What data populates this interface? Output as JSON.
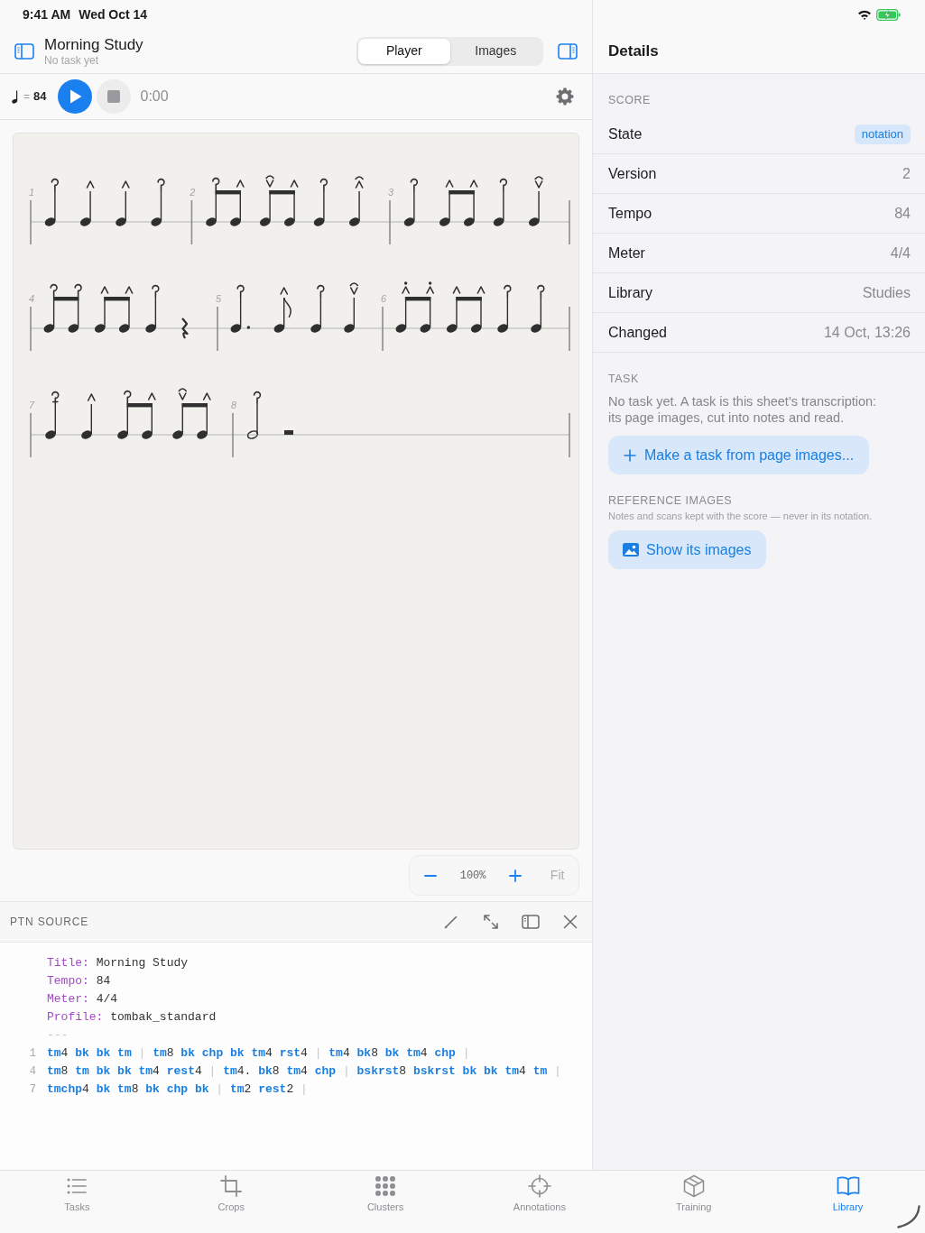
{
  "status_bar": {
    "time": "9:41 AM",
    "date": "Wed Oct 14"
  },
  "nav": {
    "title": "Morning Study",
    "subtitle": "No task yet",
    "segments": [
      {
        "label": "Player",
        "selected": true
      },
      {
        "label": "Images",
        "selected": false
      }
    ]
  },
  "player": {
    "tempo_sign": "=",
    "tempo": "84",
    "playing": false,
    "stop_disabled": true,
    "time": "0:00"
  },
  "score": {
    "systems": [
      {
        "measures": [
          {
            "number": "1",
            "items": [
              {
                "kind": "quarter",
                "marks": [
                  {
                    "kind": "hook"
                  }
                ]
              },
              {
                "kind": "quarter",
                "marks": [
                  {
                    "kind": "caret"
                  }
                ]
              },
              {
                "kind": "quarter",
                "marks": [
                  {
                    "kind": "caret"
                  }
                ]
              },
              {
                "kind": "quarter",
                "marks": [
                  {
                    "kind": "hook"
                  }
                ]
              }
            ]
          },
          {
            "number": "2",
            "items": [
              {
                "kind": "beamed_eighths",
                "marks": [
                  {
                    "kind": "hook"
                  },
                  {
                    "kind": "caret"
                  }
                ]
              },
              {
                "kind": "beamed_eighths",
                "marks": [
                  {
                    "kind": "arched_v"
                  },
                  {
                    "kind": "caret"
                  }
                ]
              },
              {
                "kind": "quarter",
                "marks": [
                  {
                    "kind": "hook"
                  }
                ]
              },
              {
                "kind": "quarter",
                "marks": [
                  {
                    "kind": "arched_caret"
                  }
                ]
              }
            ]
          },
          {
            "number": "3",
            "items": [
              {
                "kind": "quarter",
                "marks": [
                  {
                    "kind": "hook"
                  }
                ]
              },
              {
                "kind": "beamed_eighths",
                "marks": [
                  {
                    "kind": "caret"
                  },
                  {
                    "kind": "caret"
                  }
                ]
              },
              {
                "kind": "quarter",
                "marks": [
                  {
                    "kind": "hook"
                  }
                ]
              },
              {
                "kind": "quarter",
                "marks": [
                  {
                    "kind": "arched_v"
                  }
                ]
              }
            ]
          }
        ]
      },
      {
        "measures": [
          {
            "number": "4",
            "items": [
              {
                "kind": "beamed_eighths",
                "marks": [
                  {
                    "kind": "hook"
                  },
                  {
                    "kind": "hook"
                  }
                ]
              },
              {
                "kind": "beamed_eighths",
                "marks": [
                  {
                    "kind": "caret"
                  },
                  {
                    "kind": "caret"
                  }
                ]
              },
              {
                "kind": "quarter",
                "marks": [
                  {
                    "kind": "hook"
                  }
                ]
              },
              {
                "kind": "quarter_rest"
              }
            ]
          },
          {
            "number": "5",
            "items": [
              {
                "kind": "dotted_quarter",
                "marks": [
                  {
                    "kind": "hook"
                  }
                ]
              },
              {
                "kind": "eighth",
                "marks": [
                  {
                    "kind": "caret"
                  }
                ]
              },
              {
                "kind": "quarter",
                "marks": [
                  {
                    "kind": "hook"
                  }
                ]
              },
              {
                "kind": "quarter",
                "marks": [
                  {
                    "kind": "arched_v"
                  }
                ]
              }
            ]
          },
          {
            "number": "6",
            "items": [
              {
                "kind": "beamed_eighths",
                "marks": [
                  {
                    "kind": "dotted_caret"
                  },
                  {
                    "kind": "dotted_caret"
                  }
                ]
              },
              {
                "kind": "beamed_eighths",
                "marks": [
                  {
                    "kind": "caret"
                  },
                  {
                    "kind": "caret"
                  }
                ]
              },
              {
                "kind": "quarter",
                "marks": [
                  {
                    "kind": "hook"
                  }
                ]
              },
              {
                "kind": "quarter",
                "marks": [
                  {
                    "kind": "hook"
                  }
                ]
              }
            ]
          }
        ]
      },
      {
        "measures": [
          {
            "number": "7",
            "items": [
              {
                "kind": "quarter",
                "marks": [
                  {
                    "kind": "barred_hook"
                  }
                ]
              },
              {
                "kind": "quarter",
                "marks": [
                  {
                    "kind": "caret"
                  }
                ]
              },
              {
                "kind": "beamed_eighths",
                "marks": [
                  {
                    "kind": "hook"
                  },
                  {
                    "kind": "caret"
                  }
                ]
              },
              {
                "kind": "beamed_eighths",
                "marks": [
                  {
                    "kind": "arched_v"
                  },
                  {
                    "kind": "caret"
                  }
                ]
              }
            ]
          },
          {
            "number": "8",
            "items": [
              {
                "kind": "half",
                "marks": [
                  {
                    "kind": "hook"
                  }
                ]
              },
              {
                "kind": "half_rest"
              }
            ]
          }
        ]
      }
    ]
  },
  "zoom": {
    "level": "100%",
    "fit": {
      "label": "Fit",
      "disabled": true
    }
  },
  "source_panel": {
    "title": "PTN SOURCE",
    "lines": [
      {
        "kind": "meta",
        "key": "Title:",
        "value": "Morning Study"
      },
      {
        "kind": "meta",
        "key": "Tempo:",
        "value": "84"
      },
      {
        "kind": "meta",
        "key": "Meter:",
        "value": "4/4"
      },
      {
        "kind": "meta",
        "key": "Profile:",
        "value": "tombak_standard"
      },
      {
        "kind": "separator",
        "text": "---"
      },
      {
        "kind": "bars",
        "number": "1",
        "text": "tm4 bk bk tm | tm8 bk chp bk tm4 rst4 | tm4 bk8 bk tm4 chp |"
      },
      {
        "kind": "bars",
        "number": "4",
        "text": "tm8 tm bk bk tm4 rest4 | tm4. bk8 tm4 chp | bskrst8 bskrst bk bk tm4 tm |"
      },
      {
        "kind": "bars",
        "number": "7",
        "text": "tmchp4 bk tm8 bk chp bk | tm2 rest2 |"
      }
    ]
  },
  "details": {
    "title": "Details",
    "score_section": {
      "heading": "SCORE",
      "rows": [
        {
          "label": "State",
          "value": "notation",
          "kind": "badge"
        },
        {
          "label": "Version",
          "value": "2",
          "kind": "text"
        },
        {
          "label": "Tempo",
          "value": "84",
          "kind": "text"
        },
        {
          "label": "Meter",
          "value": "4/4",
          "kind": "text"
        },
        {
          "label": "Library",
          "value": "Studies",
          "kind": "text"
        },
        {
          "label": "Changed",
          "value": "14 Oct, 13:26",
          "kind": "text"
        }
      ]
    },
    "task_section": {
      "heading": "TASK",
      "text": "No task yet. A task is this sheet’s transcription: its page images, cut into notes and read.",
      "button": "Make a task from page images..."
    },
    "reference_section": {
      "heading": "REFERENCE IMAGES",
      "note": "Notes and scans kept with the score — never in its notation.",
      "button": "Show its images"
    }
  },
  "tab_bar": {
    "tabs": [
      {
        "label": "Tasks",
        "selected": false
      },
      {
        "label": "Crops",
        "selected": false
      },
      {
        "label": "Clusters",
        "selected": false
      },
      {
        "label": "Annotations",
        "selected": false
      },
      {
        "label": "Training",
        "selected": false
      },
      {
        "label": "Library",
        "selected": true
      }
    ]
  }
}
